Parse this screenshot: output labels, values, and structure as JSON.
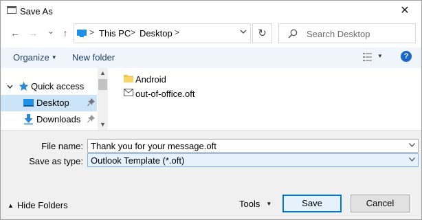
{
  "window": {
    "title": "Save As",
    "close_glyph": "✕"
  },
  "nav": {
    "back_glyph": "←",
    "forward_glyph": "→",
    "recent_glyph": "⌄",
    "up_glyph": "↑"
  },
  "address": {
    "segments": [
      "This PC",
      "Desktop"
    ],
    "separator": ">",
    "refresh_glyph": "↻"
  },
  "search": {
    "placeholder": "Search Desktop"
  },
  "toolbar": {
    "organize_label": "Organize",
    "new_folder_label": "New folder",
    "help_label": "?"
  },
  "sidebar": {
    "items": [
      {
        "label": "Quick access",
        "icon": "star-icon"
      },
      {
        "label": "Desktop",
        "icon": "desktop-icon",
        "pinned": true,
        "selected": true
      },
      {
        "label": "Downloads",
        "icon": "download-icon",
        "pinned": true
      }
    ]
  },
  "files": [
    {
      "name": "Android",
      "icon": "folder-icon"
    },
    {
      "name": "out-of-office.oft",
      "icon": "envelope-icon"
    }
  ],
  "form": {
    "file_name_label": "File name:",
    "file_name_value": "Thank you for your message.oft",
    "save_type_label": "Save as type:",
    "save_type_value": "Outlook Template (*.oft)"
  },
  "footer": {
    "hide_folders_label": "Hide Folders",
    "tools_label": "Tools",
    "save_label": "Save",
    "cancel_label": "Cancel"
  },
  "colors": {
    "accent": "#0078d7",
    "selection": "#cce4f7",
    "toolbar_bg": "#f0f5fb",
    "folder": "#f2c246",
    "help": "#1a66c9"
  }
}
